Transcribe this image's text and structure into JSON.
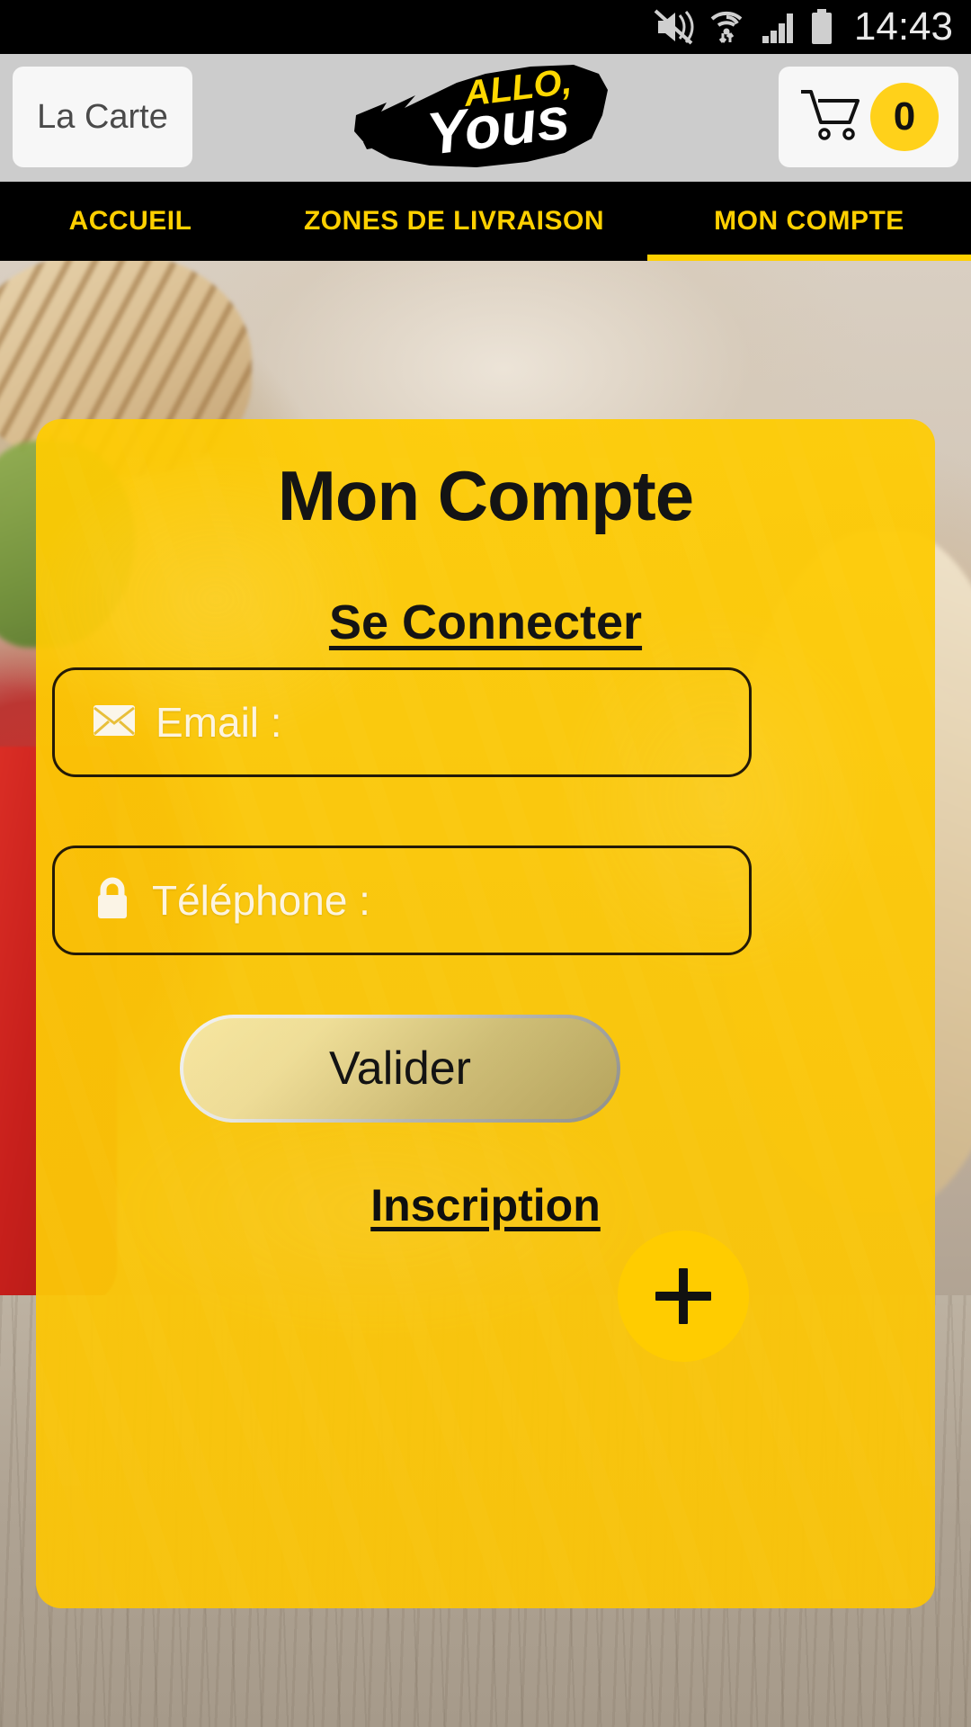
{
  "status_bar": {
    "time": "14:43",
    "icons": [
      "mute-vibrate-icon",
      "wifi-icon",
      "signal-bars-icon",
      "battery-icon"
    ]
  },
  "header": {
    "menu_button_label": "La Carte",
    "logo": {
      "top_text": "ALLO,",
      "bottom_text": "Yous",
      "top_color": "#ffd800",
      "bottom_color": "#ffffff"
    },
    "cart": {
      "icon": "shopping-cart-icon",
      "count": "0",
      "badge_color": "#ffd11a"
    }
  },
  "nav": {
    "tabs": [
      {
        "label": "ACCUEIL",
        "active": false
      },
      {
        "label": "ZONES DE LIVRAISON",
        "active": false
      },
      {
        "label": "MON COMPTE",
        "active": true
      }
    ],
    "text_color": "#ffd000",
    "background": "#000000"
  },
  "card": {
    "title": "Mon Compte",
    "login_link": "Se Connecter",
    "background_color": "#ffcc00",
    "fields": [
      {
        "icon": "envelope-icon",
        "label": "Email :",
        "value": "",
        "placeholder": "Email :"
      },
      {
        "icon": "lock-icon",
        "label": "Téléphone :",
        "value": "",
        "placeholder": "Téléphone :"
      }
    ],
    "submit_label": "Valider",
    "signup_link": "Inscription"
  },
  "fab": {
    "icon": "plus-icon",
    "label": "+",
    "color": "#ffcc00"
  }
}
